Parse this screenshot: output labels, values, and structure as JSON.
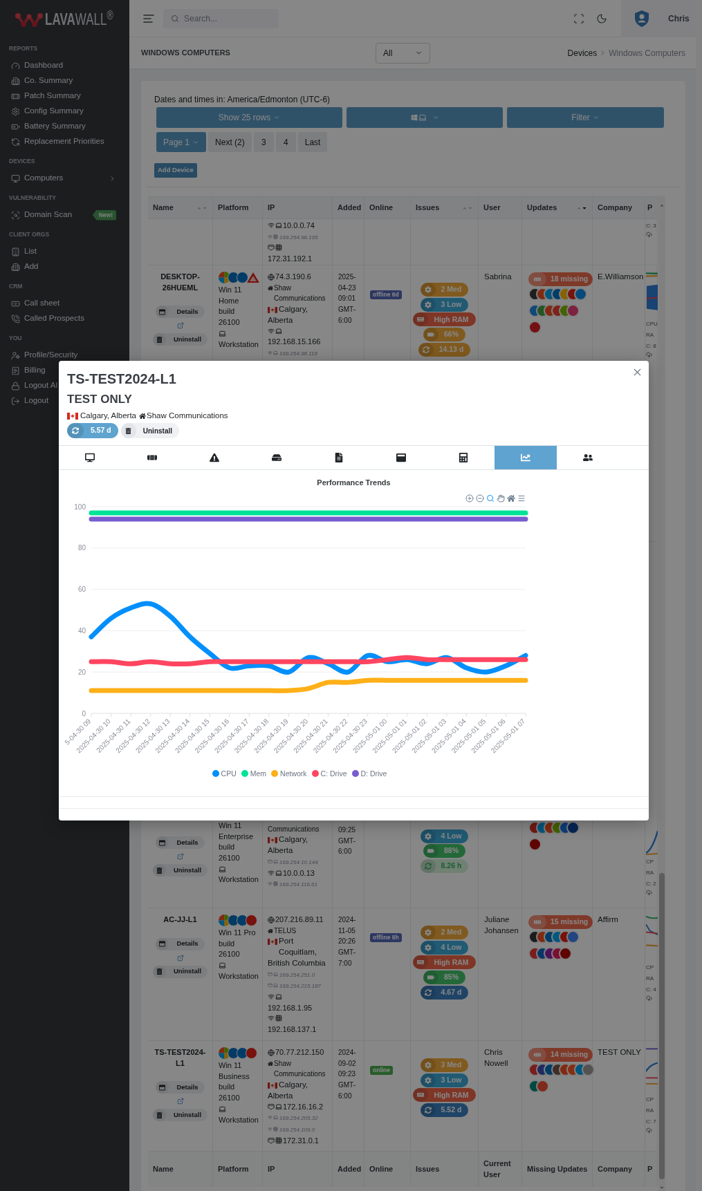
{
  "sidebar": {
    "logo": "**LAVA**WALL$^{®}$",
    "sections": [
      {
        "heading": "REPORTS",
        "items": [
          {
            "label": "Dashboard",
            "expandable": false
          },
          {
            "label": "Co. Summary",
            "expandable": false
          },
          {
            "label": "Patch Summary",
            "expandable": false
          },
          {
            "label": "Config Summary",
            "expandable": false
          },
          {
            "label": "Battery Summary",
            "expandable": false
          },
          {
            "label": "Replacement Priorities",
            "expandable": false
          }
        ]
      },
      {
        "heading": "DEVICES",
        "items": [
          {
            "label": "Computers",
            "expandable": true
          }
        ]
      },
      {
        "heading": "VULNERABILITY",
        "items": [
          {
            "label": "Domain Scan",
            "expandable": false,
            "badge": "New!"
          }
        ]
      },
      {
        "heading": "CLIENT ORGS",
        "items": [
          {
            "label": "List",
            "expandable": false
          },
          {
            "label": "Add",
            "expandable": false
          }
        ]
      },
      {
        "heading": "CRM",
        "items": [
          {
            "label": "Call sheet",
            "expandable": false
          },
          {
            "label": "Called Prospects",
            "expandable": false
          }
        ]
      },
      {
        "heading": "YOU",
        "items": [
          {
            "label": "Profile/Security",
            "expandable": false
          },
          {
            "label": "Billing"
          },
          {
            "label": "Logout Al"
          },
          {
            "label": "Logout"
          }
        ]
      }
    ]
  },
  "topbar": {
    "search": {
      "placeholder": "Search..."
    },
    "user": {
      "name": "Chris"
    }
  },
  "page_header": {
    "title": "WINDOWS COMPUTERS",
    "filter": {
      "value": "All"
    },
    "breadcrumb": [
      "Devices",
      "Windows Computers"
    ]
  },
  "controls": {
    "timezone_note": "Dates and times in: America/Edmonton (UTC-6)",
    "buttons": [
      {
        "kind": "text",
        "label": "Show 25 rows"
      },
      {
        "kind": "device_type"
      },
      {
        "kind": "text",
        "label": "Filter"
      }
    ],
    "pages": [
      {
        "label": "Page 1",
        "selected": true
      },
      {
        "label": "Next (2)",
        "selected": false
      },
      {
        "label": "3",
        "selected": false
      },
      {
        "label": "4",
        "selected": false
      },
      {
        "label": "Last",
        "selected": false
      }
    ],
    "add_button": "Add Device"
  },
  "table": {
    "columns": [
      {
        "label": "Name",
        "sortable": true,
        "sorted": false
      },
      {
        "label": "Platform",
        "sortable": false
      },
      {
        "label": "IP",
        "sortable": false
      },
      {
        "label": "Added",
        "sortable": false
      },
      {
        "label": "Online",
        "sortable": false
      },
      {
        "label": "Issues",
        "sortable": true,
        "sorted": false
      },
      {
        "label": "User",
        "sortable": false
      },
      {
        "label": "Updates",
        "sortable": true,
        "sorted": true
      },
      {
        "label": "Company",
        "sortable": false
      },
      {
        "label": "P",
        "sortable": false
      }
    ],
    "rows": [
      {
        "kind": "clipped",
        "ip": [
          {
            "kind": "local",
            "wireless": true,
            "virtual": false,
            "text": "10.0.0.74"
          },
          {
            "kind": "link_local",
            "wireless": true,
            "virtual": true,
            "text": "169.254.96.195"
          },
          {
            "kind": "local",
            "wireless": false,
            "virtual": true,
            "text": "172.31.192.1"
          }
        ],
        "column_10": {
          "lines": [
            "C: 3"
          ]
        }
      },
      {
        "kind": "full",
        "name": "DESKTOP-26HUEML",
        "actions": {
          "details": "Details",
          "uninstall": "Uninstall"
        },
        "platform": {
          "os": "Win 11 Home",
          "build": "build 26100",
          "form": "Workstation"
        },
        "ip": [
          {
            "kind": "public",
            "text": "74.3.190.6"
          },
          {
            "kind": "isp",
            "text": "Shaw Communications"
          },
          {
            "kind": "location",
            "city": "Calgary,",
            "region": "Alberta"
          },
          {
            "kind": "local",
            "wireless": true,
            "virtual": false,
            "text": "192.168.15.166"
          },
          {
            "kind": "link_local",
            "wireless": true,
            "virtual": false,
            "text": "169.254.98.118"
          }
        ],
        "added": "2025-04-23 09:01 GMT-6:00",
        "online": {
          "text": "offline 6d",
          "color": "#2d3762"
        },
        "issues": [
          {
            "kind": "config",
            "text": "2 Med",
            "color": "#805a1f"
          },
          {
            "kind": "config",
            "text": "3 Low",
            "color": "#215a73"
          },
          {
            "kind": "memory",
            "text": "High RAM",
            "color": "#7f3626"
          },
          {
            "kind": "battery",
            "text": "66%",
            "color": "#805a1f"
          },
          {
            "kind": "uptime",
            "text": "14.13 d",
            "color": "#805a1f"
          }
        ],
        "user": "Sabrina",
        "updates": {
          "missing": "18 missing"
        },
        "company": "E.Williamson",
        "column_10": {
          "lines": [
            "CPU",
            "RA",
            "C: 8"
          ]
        }
      },
      {
        "kind": "covered",
        "actions": {
          "details": "Details",
          "uninstall": "Uninstall"
        },
        "platform": {
          "os": "Win 11 Enterprise",
          "build": "build 26100",
          "form": "Workstation"
        },
        "ip": [
          {
            "kind": "isp_continued",
            "text": "Communications"
          },
          {
            "kind": "location",
            "city": "Calgary,",
            "region": "Alberta"
          },
          {
            "kind": "link_local",
            "wireless": false,
            "virtual": false,
            "text": "169.254.10.144"
          },
          {
            "kind": "local",
            "wireless": true,
            "virtual": false,
            "text": "10.0.0.13"
          },
          {
            "kind": "link_local",
            "wireless": true,
            "virtual": true,
            "text": "169.254.116.61"
          }
        ],
        "added": "09:25 GMT-6:00",
        "issues": [
          {
            "kind": "config",
            "text": "4 Low",
            "color": "#215a73"
          },
          {
            "kind": "battery",
            "text": "88%",
            "color": "#246839"
          },
          {
            "kind": "uptime",
            "text": "8.26 h",
            "color": "#708174"
          }
        ],
        "column_10": {
          "lines": [
            "CP",
            "RA",
            "C: 2"
          ]
        }
      },
      {
        "kind": "full",
        "name": "AC-JJ-L1",
        "actions": {
          "details": "Details",
          "uninstall": "Uninstall"
        },
        "platform": {
          "os": "Win 11 Pro",
          "build": "build 26100",
          "form": "Workstation"
        },
        "ip": [
          {
            "kind": "public",
            "text": "207.216.89.11"
          },
          {
            "kind": "isp",
            "text": "TELUS"
          },
          {
            "kind": "location",
            "city": "Port Coquitlam,",
            "region": "British Columbia"
          },
          {
            "kind": "link_local",
            "wireless": false,
            "virtual": false,
            "text": "169.254.251.0"
          },
          {
            "kind": "link_local",
            "wireless": false,
            "virtual": false,
            "text": "169.254.215.187"
          },
          {
            "kind": "local",
            "wireless": true,
            "virtual": false,
            "text": "192.168.1.95"
          },
          {
            "kind": "local",
            "wireless": true,
            "virtual": true,
            "text": "192.168.137.1"
          }
        ],
        "added": "2024-11-05 20:26 GMT-7:00",
        "online": {
          "text": "offline 8h",
          "color": "#2d3762"
        },
        "issues": [
          {
            "kind": "config",
            "text": "2 Med",
            "color": "#805a1f"
          },
          {
            "kind": "config",
            "text": "4 Low",
            "color": "#215a73"
          },
          {
            "kind": "memory",
            "text": "High RAM",
            "color": "#7f3626"
          },
          {
            "kind": "battery",
            "text": "85%",
            "color": "#246839"
          },
          {
            "kind": "uptime",
            "text": "4.67 d",
            "color": "#204466"
          }
        ],
        "user": "Juliane Johansen",
        "updates": {
          "missing": "15 missing"
        },
        "company": "Affirm",
        "column_10": {
          "lines": [
            "CP",
            "RA",
            "C: 4"
          ]
        }
      },
      {
        "kind": "full",
        "name": "TS-TEST2024-L1",
        "actions": {
          "details": "Details",
          "uninstall": "Uninstall"
        },
        "platform": {
          "os": "Win 11 Business",
          "build": "build 26100",
          "form": "Workstation"
        },
        "ip": [
          {
            "kind": "public",
            "text": "70.77.212.150"
          },
          {
            "kind": "isp",
            "text": "Shaw Communications"
          },
          {
            "kind": "location",
            "city": "Calgary,",
            "region": "Alberta"
          },
          {
            "kind": "local",
            "wireless": false,
            "virtual": false,
            "text": "172.16.16.2"
          },
          {
            "kind": "link_local",
            "wireless": true,
            "virtual": false,
            "text": "169.254.205.32"
          },
          {
            "kind": "link_local",
            "wireless": true,
            "virtual": true,
            "text": "169.254.109.0"
          },
          {
            "kind": "local",
            "wireless": false,
            "virtual": true,
            "text": "172.31.0.1"
          }
        ],
        "added": "2024-09-02 09:23 GMT-6:00",
        "online": {
          "text": "online",
          "color": "#285d2a"
        },
        "issues": [
          {
            "kind": "config",
            "text": "3 Med",
            "color": "#805a1f"
          },
          {
            "kind": "config",
            "text": "3 Low",
            "color": "#215a73"
          },
          {
            "kind": "memory",
            "text": "High RAM",
            "color": "#7f3626"
          },
          {
            "kind": "uptime",
            "text": "5.52 d",
            "color": "#204466"
          }
        ],
        "user": "Chris Nowell",
        "updates": {
          "missing": "14 missing"
        },
        "company": "TEST ONLY",
        "column_10": {
          "lines": [
            "CP",
            "RA",
            "C: 7"
          ]
        }
      }
    ],
    "footer_columns": [
      "Name",
      "Platform",
      "IP",
      "Added",
      "Online",
      "Issues",
      "Current User",
      "Missing Updates",
      "Company",
      "P"
    ]
  },
  "modal": {
    "title": "TS-TEST2024-L1",
    "subtitle": "TEST ONLY",
    "location": "Calgary, Alberta",
    "isp": "Shaw Communications",
    "uptime": {
      "text": "5.57 d",
      "color": "#5ea4cf"
    },
    "uninstall": "Uninstall",
    "tabs": [
      {
        "selected": false
      },
      {
        "selected": false
      },
      {
        "selected": false
      },
      {
        "selected": false
      },
      {
        "selected": false
      },
      {
        "selected": false
      },
      {
        "selected": false
      },
      {
        "selected": true
      },
      {
        "selected": false
      }
    ],
    "toolbar": [
      {
        "selected": false
      },
      {
        "selected": false
      },
      {
        "selected": true
      },
      {
        "selected": false
      },
      {
        "selected": false
      },
      {
        "selected": false
      }
    ],
    "chart_data": {
      "type": "line",
      "title": "Performance Trends",
      "grid": true,
      "legend": true,
      "categories": [
        "5-04-30 09",
        "2025-04-30 10",
        "2025-04-30 11",
        "2025-04-30 12",
        "2025-04-30 13",
        "2025-04-30 14",
        "2025-04-30 15",
        "2025-04-30 16",
        "2025-04-30 17",
        "2025-04-30 18",
        "2025-04-30 19",
        "2025-04-30 20",
        "2025-04-30 21",
        "2025-04-30 22",
        "2025-04-30 23",
        "2025-05-01 00",
        "2025-05-01 01",
        "2025-05-01 02",
        "2025-05-01 03",
        "2025-05-01 04",
        "2025-05-01 05",
        "2025-05-01 06",
        "2025-05-01 07"
      ],
      "series": [
        {
          "name": "CPU",
          "color": "#008ffb",
          "values": [
            37,
            46,
            51,
            53,
            47,
            37,
            29,
            22,
            23,
            23,
            20,
            27,
            24,
            20,
            28,
            25,
            26,
            24,
            27,
            22,
            20,
            23,
            28
          ]
        },
        {
          "name": "Mem",
          "color": "#00e396",
          "values": [
            97,
            97,
            97,
            97,
            97,
            97,
            97,
            97,
            97,
            97,
            97,
            97,
            97,
            97,
            97,
            97,
            97,
            97,
            97,
            97,
            97,
            97,
            97
          ]
        },
        {
          "name": "Network",
          "color": "#feb019",
          "values": [
            11,
            11,
            11,
            11,
            11,
            11,
            11,
            11,
            11,
            11,
            11,
            12,
            15,
            15,
            16,
            16,
            16,
            16,
            16,
            16,
            16,
            16,
            16
          ]
        },
        {
          "name": "C: Drive",
          "color": "#ff4560",
          "values": [
            25,
            25,
            24,
            25,
            24,
            24,
            25,
            25,
            25,
            25,
            25,
            25,
            25,
            25,
            25,
            26,
            27,
            26,
            26,
            26,
            26,
            26,
            26
          ]
        },
        {
          "name": "D: Drive",
          "color": "#775dd0",
          "values": [
            94,
            94,
            94,
            94,
            94,
            94,
            94,
            94,
            94,
            94,
            94,
            94,
            94,
            94,
            94,
            94,
            94,
            94,
            94,
            94,
            94,
            94,
            94
          ]
        }
      ],
      "ylim": [
        0,
        100
      ],
      "yticks": [
        0,
        20,
        40,
        60,
        80,
        100
      ]
    }
  }
}
